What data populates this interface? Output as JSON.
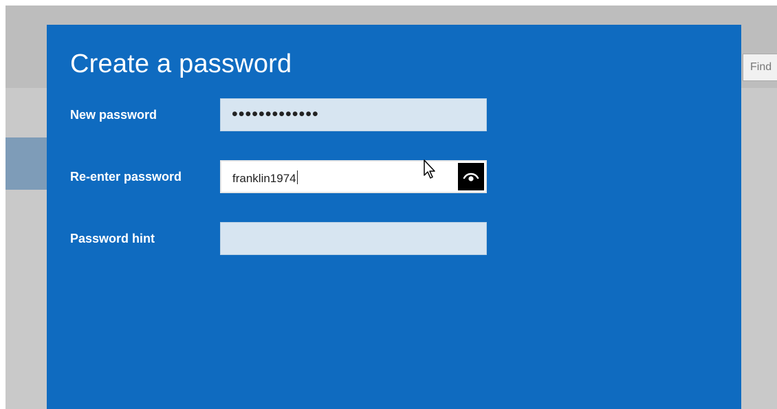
{
  "background": {
    "find_label": "Find"
  },
  "dialog": {
    "title": "Create a password",
    "new_password": {
      "label": "New password",
      "masked_value": "•••••••••••••"
    },
    "reenter_password": {
      "label": "Re-enter password",
      "value": "franklin1974",
      "reveal_icon": "eye-icon"
    },
    "password_hint": {
      "label": "Password hint",
      "value": ""
    }
  },
  "colors": {
    "dialog_bg": "#0f6bc0",
    "field_bg": "#d7e5f1",
    "active_field_bg": "#ffffff",
    "reveal_button_bg": "#000000"
  }
}
